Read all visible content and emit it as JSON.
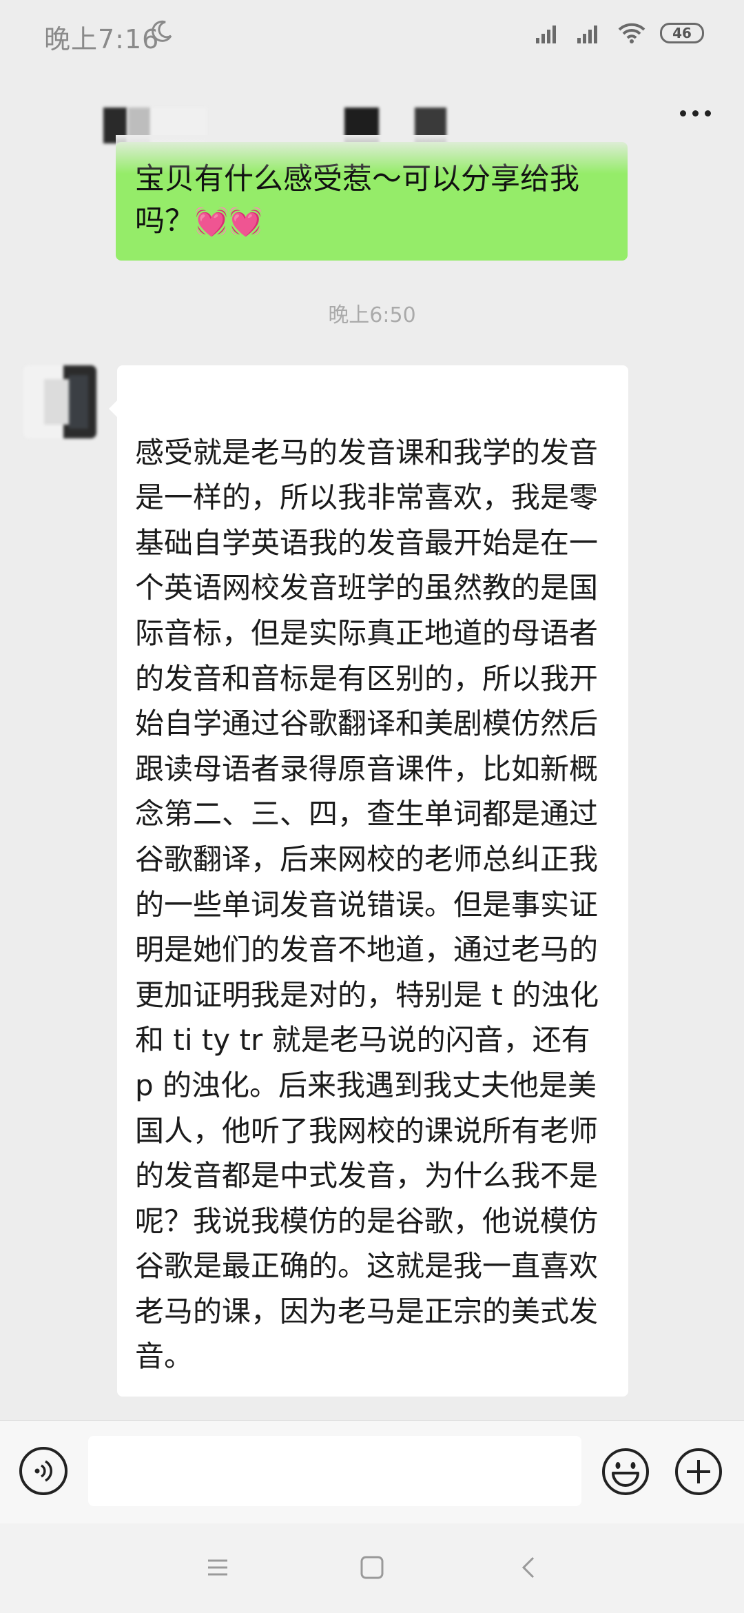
{
  "status_bar": {
    "time": "晚上7:16",
    "battery": "46",
    "icons": [
      "moon-icon",
      "signal-icon",
      "signal-icon",
      "wifi-icon",
      "battery-icon"
    ]
  },
  "title_bar": {
    "contact_name_icon": "blurred-contact-name",
    "more_icon": "more-icon"
  },
  "messages": [
    {
      "direction": "outgoing",
      "text": "宝贝有什么感受惹～可以分享给我吗？",
      "emoji": "💓💓"
    },
    {
      "type": "timestamp",
      "text": "晚上6:50"
    },
    {
      "direction": "incoming",
      "text": "感受就是老马的发音课和我学的发音是一样的，所以我非常喜欢，我是零基础自学英语我的发音最开始是在一个英语网校发音班学的虽然教的是国际音标，但是实际真正地道的母语者的发音和音标是有区别的，所以我开始自学通过谷歌翻译和美剧模仿然后跟读母语者录得原音课件，比如新概念第二、三、四，查生单词都是通过谷歌翻译，后来网校的老师总纠正我的一些单词发音说错误。但是事实证明是她们的发音不地道，通过老马的更加证明我是对的，特别是 t 的浊化和 ti ty tr 就是老马说的闪音，还有 p 的浊化。后来我遇到我丈夫他是美国人，他听了我网校的课说所有老师的发音都是中式发音，为什么我不是呢？我说我模仿的是谷歌，他说模仿谷歌是最正确的。这就是我一直喜欢老马的课，因为老马是正宗的美式发音。"
    }
  ],
  "input_bar": {
    "value": "",
    "icons": [
      "voice-icon",
      "emoji-icon",
      "add-icon"
    ]
  },
  "nav_bar": {
    "icons": [
      "menu-icon",
      "home-icon",
      "back-icon"
    ]
  },
  "colors": {
    "background": "#ededed",
    "outgoing_bubble": "#95ec69",
    "incoming_bubble": "#ffffff"
  }
}
